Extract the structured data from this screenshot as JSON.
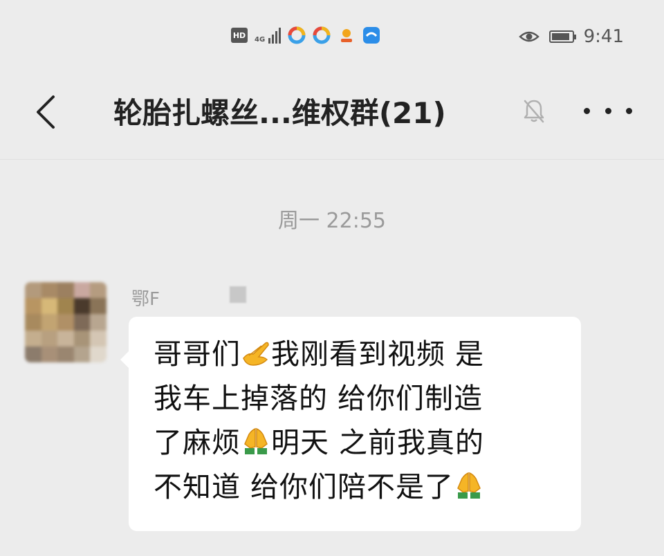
{
  "status_bar": {
    "hd": "HD",
    "network": "4G",
    "time": "9:41",
    "battery_level": 0.9
  },
  "header": {
    "title": "轮胎扎螺丝...维权群(21)"
  },
  "chat": {
    "time_divider": "周一 22:55",
    "message": {
      "sender": "鄂F",
      "lines": [
        {
          "parts": [
            "哥哥们",
            "@wave",
            "我刚看到视频 是"
          ]
        },
        {
          "parts": [
            "我车上掉落的 给你们制造"
          ]
        },
        {
          "parts": [
            "了麻烦",
            "@pray",
            "明天 之前我真的"
          ]
        },
        {
          "parts": [
            "不知道 给你们陪不是了",
            "@pray"
          ]
        }
      ],
      "text_segments": {
        "l1a": "哥哥们",
        "l1b": "我刚看到视频 是",
        "l2": "我车上掉落的 给你们制造",
        "l3a": "了麻烦",
        "l3b": "明天 之前我真的",
        "l4": "不知道 给你们陪不是了"
      }
    }
  },
  "colors": {
    "background": "#ececec",
    "bubble": "#ffffff",
    "secondary_text": "#9a9a9a",
    "primary_text": "#111111"
  }
}
